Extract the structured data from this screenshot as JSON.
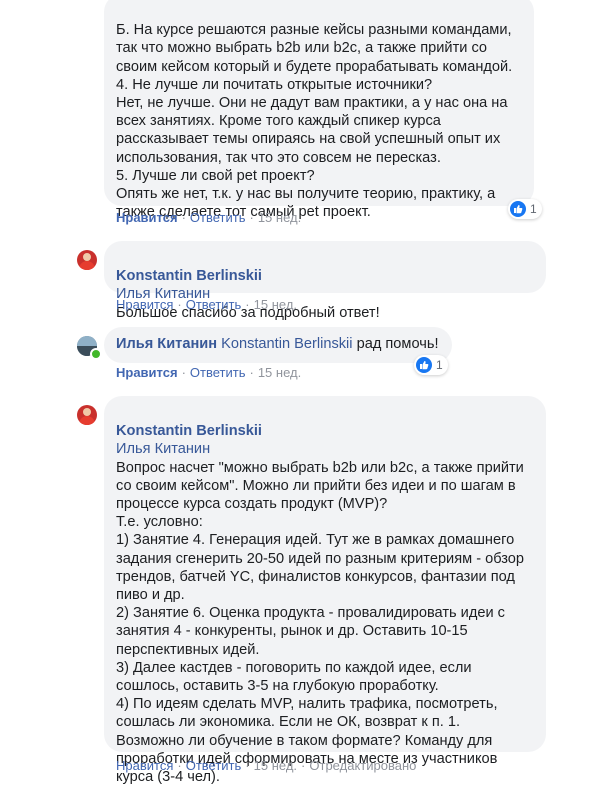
{
  "comments": [
    {
      "text": "Б. На курсе решаются разные кейсы разными командами, так что можно выбрать b2b или b2c, а также прийти со своим кейсом который и будете прорабатывать командой.\n4. Не лучше ли почитать открытые источники?\nНет, не лучше. Они не дадут вам практики, а у нас она на всех занятиях. Кроме того каждый спикер курса рассказывает темы опираясь на свой успешный опыт их использования, так что это совсем не пересказ.\n5. Лучше ли свой pet проект?\nОпять же нет, т.к. у нас вы получите теорию, практику, а также сделаете тот самый pet проект.",
      "like_label": "Нравится",
      "reply_label": "Ответить",
      "time": "15 нед.",
      "reactions": "1"
    },
    {
      "author": "Konstantin Berlinskii",
      "mention": "Илья Китанин",
      "text": "Большое спасибо за подробный ответ!",
      "like_label": "Нравится",
      "reply_label": "Ответить",
      "time": "15 нед."
    },
    {
      "author": "Илья Китанин",
      "mention": "Konstantin Berlinskii",
      "text": "рад помочь!",
      "like_label": "Нравится",
      "reply_label": "Ответить",
      "time": "15 нед.",
      "reactions": "1"
    },
    {
      "author": "Konstantin Berlinskii",
      "mention": "Илья Китанин",
      "text": "Вопрос насчет \"можно выбрать b2b или b2c, а также прийти со своим кейсом\". Можно ли прийти без идеи и по шагам в процессе курса создать продукт (MVP)?\nТ.е. условно:\n1) Занятие 4. Генерация идей. Тут же в рамках домашнего задания сгенерить 20-50 идей по разным критериям - обзор трендов, батчей YC, финалистов конкурсов, фантазии под пиво и др.\n2) Занятие 6. Оценка продукта - провалидировать идеи с занятия 4 - конкуренты, рынок и др. Оставить 10-15 перспективных идей.\n3) Далее кастдев - поговорить по каждой идее, если сошлось, оставить 3-5 на глубокую проработку.\n4) По идеям сделать MVP, налить трафика, посмотреть, сошлась ли экономика. Если не ОК, возврат к п. 1.\nВозможно ли обучение в таком формате? Команду для проработки идей сформировать на месте из участников курса (3-4 чел).",
      "like_label": "Нравится",
      "reply_label": "Ответить",
      "time": "15 нед.",
      "edited": "Отредактировано"
    }
  ],
  "icons": {
    "avatar_kb": "avatar-red-shirt",
    "avatar_ik": "avatar-landscape",
    "reaction": "thumbs-up-icon"
  },
  "colors": {
    "link": "#385898",
    "action": "#4267b2",
    "bubble": "#f2f3f5",
    "like_reaction": "#1877f2",
    "online": "#42b72a"
  }
}
